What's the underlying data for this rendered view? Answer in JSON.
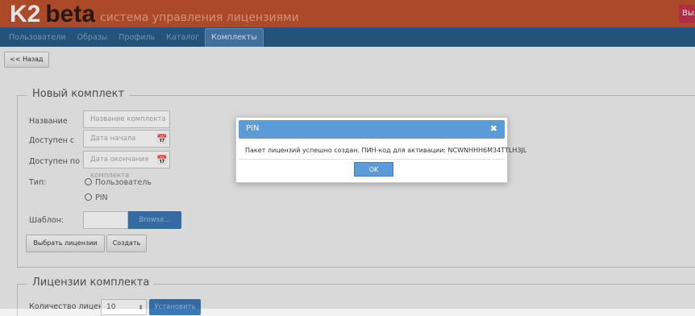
{
  "header": {
    "logo_main": "K2",
    "logo_beta": "beta",
    "subtitle": "система управления лицензиями",
    "exit_label": "Выход"
  },
  "nav": {
    "items": [
      {
        "label": "Пользователи"
      },
      {
        "label": "Образы"
      },
      {
        "label": "Профиль"
      },
      {
        "label": "Каталог"
      },
      {
        "label": "Комплекты",
        "active": true
      }
    ]
  },
  "back_label": "<< Назад",
  "new_kit": {
    "title": "Новый комплект",
    "name_label": "Название",
    "name_placeholder": "Название комплекта",
    "from_label": "Доступен с",
    "from_placeholder": "Дата начала комплекта",
    "to_label": "Доступен по",
    "to_placeholder": "Дата окончания комплекта",
    "type_label": "Тип:",
    "type_options": [
      "Пользователь",
      "PIN"
    ],
    "template_label": "Шаблон:",
    "browse_label": "Browse...",
    "select_licenses_label": "Выбрать лицензии",
    "create_label": "Создать"
  },
  "kit_licenses": {
    "title": "Лицензии комплекта",
    "count_label": "Количество лицензий:",
    "count_value": "10",
    "set_label": "Установить"
  },
  "dialog": {
    "title": "PIN",
    "message": "Пакет лицензий успешно создан. ПИН-код для активации: NCWNHHH6M34TTLH3JL",
    "ok_label": "OK"
  },
  "icons": {
    "calendar": "calendar-icon",
    "close": "close-icon",
    "spinner": "spinner-icon"
  },
  "colors": {
    "header_bg": "#c0522e",
    "nav_bg": "#2a5c86",
    "accent": "#5b9bd8"
  }
}
